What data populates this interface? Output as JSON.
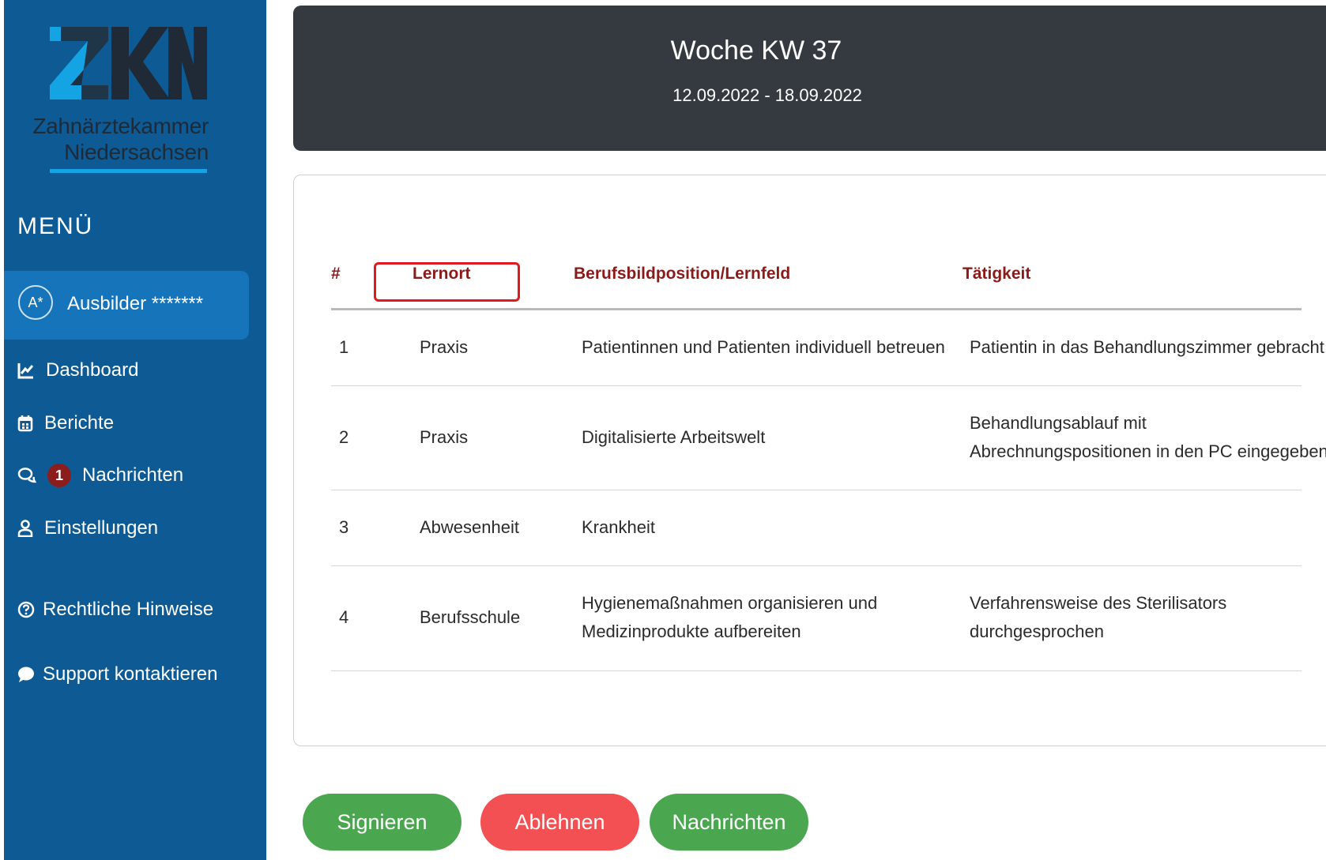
{
  "logo": {
    "line1": "Zahnärztekammer",
    "line2": "Niedersachsen",
    "colors": {
      "dark": "#1f2a36",
      "accent": "#14a3e3"
    }
  },
  "sidebar": {
    "menu_title": "MENÜ",
    "user": {
      "avatar": "A*",
      "name": "Ausbilder *******"
    },
    "items": [
      {
        "label": "Dashboard",
        "icon": "chart-line-icon"
      },
      {
        "label": "Berichte",
        "icon": "calendar-icon"
      },
      {
        "label": "Nachrichten",
        "icon": "chat-icon",
        "badge": "1"
      },
      {
        "label": "Einstellungen",
        "icon": "user-icon"
      },
      {
        "label": "Rechtliche Hinweise",
        "icon": "question-circle-icon"
      },
      {
        "label": "Support kontaktieren",
        "icon": "speech-bubble-icon"
      }
    ]
  },
  "header": {
    "title": "Woche KW 37",
    "date_range": "12.09.2022 - 18.09.2022"
  },
  "table": {
    "columns": [
      "#",
      "Lernort",
      "Berufsbildposition/Lernfeld",
      "Tätigkeit"
    ],
    "rows": [
      {
        "num": "1",
        "lernort": "Praxis",
        "position": [
          "Patientinnen und Patienten individuell betreuen"
        ],
        "taetigkeit": [
          "Patientin in das Behandlungszimmer gebracht"
        ]
      },
      {
        "num": "2",
        "lernort": "Praxis",
        "position": [
          "Digitalisierte Arbeitswelt"
        ],
        "taetigkeit": [
          "Behandlungsablauf mit",
          "Abrechnungspositionen in den PC eingegeben"
        ]
      },
      {
        "num": "3",
        "lernort": "Abwesenheit",
        "position": [
          "Krankheit"
        ],
        "taetigkeit": []
      },
      {
        "num": "4",
        "lernort": "Berufsschule",
        "position": [
          "Hygienemaßnahmen organisieren und",
          "Medizinprodukte aufbereiten"
        ],
        "taetigkeit": [
          "Verfahrensweise des Sterilisators",
          "durchgesprochen"
        ]
      }
    ]
  },
  "actions": {
    "sign": "Signieren",
    "reject": "Ablehnen",
    "messages": "Nachrichten"
  },
  "colors": {
    "sidebar": "#0d5a94",
    "header": "#343a40",
    "column_header": "#8b1a1a",
    "green": "#4aa750",
    "red": "#f25053",
    "highlight": "#e0191f"
  }
}
